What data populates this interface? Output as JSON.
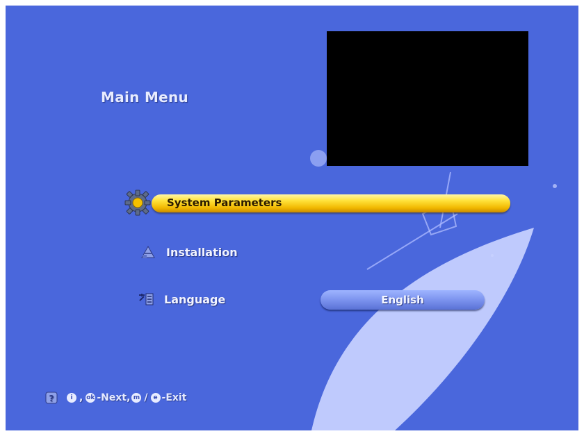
{
  "menu": {
    "title": "Main Menu",
    "items": [
      {
        "label": "System Parameters",
        "icon": "gear-icon",
        "selected": true
      },
      {
        "label": "Installation",
        "icon": "dish-icon",
        "selected": false
      },
      {
        "label": "Language",
        "icon": "language-icon",
        "selected": false,
        "value": "English"
      }
    ]
  },
  "footer": {
    "keys": [
      {
        "glyph": "i"
      },
      {
        "glyph": "ok"
      },
      {
        "glyph": "m"
      },
      {
        "glyph": "e"
      }
    ],
    "comma": ",",
    "next_label": "-Next,",
    "slash": "/",
    "exit_label": "-Exit"
  },
  "colors": {
    "background": "#4a67dc",
    "highlight": "#ffe23a",
    "value_pill": "#7c93ee"
  }
}
